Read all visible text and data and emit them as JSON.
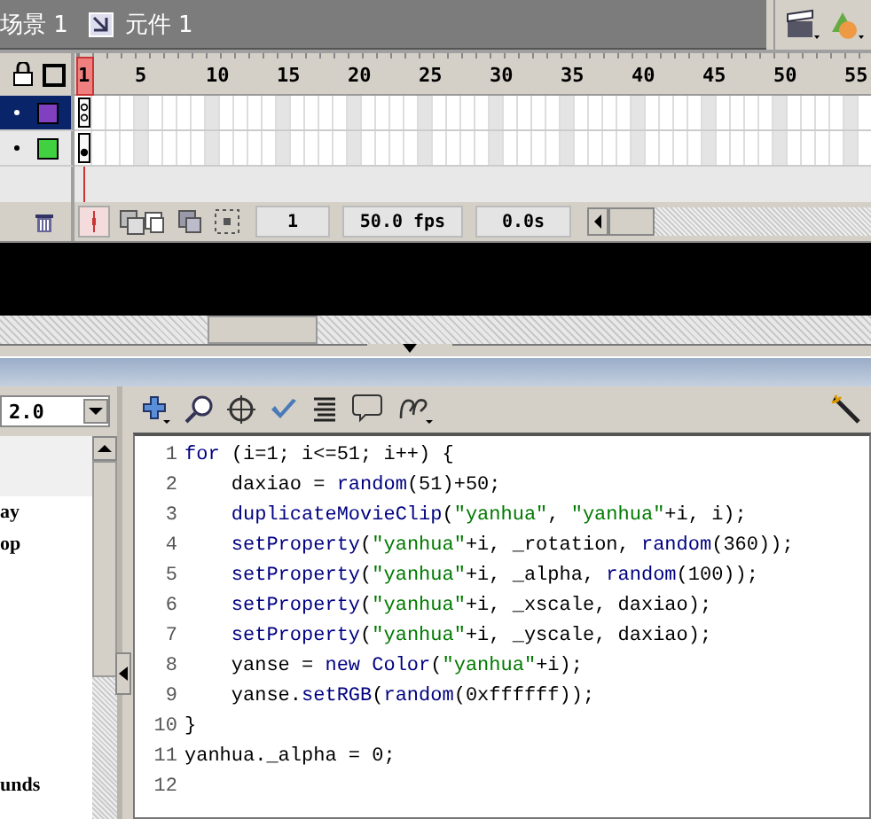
{
  "breadcrumb": [
    {
      "label": "场景 1",
      "kind": "scene"
    },
    {
      "label": "元件 1",
      "kind": "symbol"
    }
  ],
  "timeline": {
    "ruler": [
      "1",
      "5",
      "10",
      "15",
      "20",
      "25",
      "30",
      "35",
      "40",
      "45",
      "50",
      "55"
    ],
    "layers": [
      {
        "selected": true,
        "color": "#8040c0",
        "kind": "action"
      },
      {
        "selected": false,
        "color": "#40d040",
        "kind": "filled"
      }
    ],
    "current_frame": "1",
    "frame_rate": "50.0 fps",
    "elapsed": "0.0s"
  },
  "actions": {
    "version": "2.0",
    "list": [
      {
        "label": "ay"
      },
      {
        "label": "op"
      },
      {
        "label": "unds"
      }
    ],
    "code": [
      {
        "number": "1",
        "segments": [
          {
            "text": "for",
            "kind": "keyword"
          },
          {
            "text": " (i=1; i<=51; i++) {",
            "kind": "plain"
          }
        ]
      },
      {
        "number": "2",
        "segments": [
          {
            "text": "    daxiao = ",
            "kind": "plain"
          },
          {
            "text": "random",
            "kind": "keyword"
          },
          {
            "text": "(51)+50;",
            "kind": "plain"
          }
        ]
      },
      {
        "number": "3",
        "segments": [
          {
            "text": "    duplicateMovieClip",
            "kind": "keyword"
          },
          {
            "text": "(",
            "kind": "plain"
          },
          {
            "text": "\"yanhua\"",
            "kind": "string"
          },
          {
            "text": ", ",
            "kind": "plain"
          },
          {
            "text": "\"yanhua\"",
            "kind": "string"
          },
          {
            "text": "+i, i);",
            "kind": "plain"
          }
        ]
      },
      {
        "number": "4",
        "segments": [
          {
            "text": "    setProperty",
            "kind": "keyword"
          },
          {
            "text": "(",
            "kind": "plain"
          },
          {
            "text": "\"yanhua\"",
            "kind": "string"
          },
          {
            "text": "+i, _rotation, ",
            "kind": "plain"
          },
          {
            "text": "random",
            "kind": "keyword"
          },
          {
            "text": "(360));",
            "kind": "plain"
          }
        ]
      },
      {
        "number": "5",
        "segments": [
          {
            "text": "    setProperty",
            "kind": "keyword"
          },
          {
            "text": "(",
            "kind": "plain"
          },
          {
            "text": "\"yanhua\"",
            "kind": "string"
          },
          {
            "text": "+i, _alpha, ",
            "kind": "plain"
          },
          {
            "text": "random",
            "kind": "keyword"
          },
          {
            "text": "(100));",
            "kind": "plain"
          }
        ]
      },
      {
        "number": "6",
        "segments": [
          {
            "text": "    setProperty",
            "kind": "keyword"
          },
          {
            "text": "(",
            "kind": "plain"
          },
          {
            "text": "\"yanhua\"",
            "kind": "string"
          },
          {
            "text": "+i, _xscale, daxiao);",
            "kind": "plain"
          }
        ]
      },
      {
        "number": "7",
        "segments": [
          {
            "text": "    setProperty",
            "kind": "keyword"
          },
          {
            "text": "(",
            "kind": "plain"
          },
          {
            "text": "\"yanhua\"",
            "kind": "string"
          },
          {
            "text": "+i, _yscale, daxiao);",
            "kind": "plain"
          }
        ]
      },
      {
        "number": "8",
        "segments": [
          {
            "text": "    yanse = ",
            "kind": "plain"
          },
          {
            "text": "new Color",
            "kind": "keyword"
          },
          {
            "text": "(",
            "kind": "plain"
          },
          {
            "text": "\"yanhua\"",
            "kind": "string"
          },
          {
            "text": "+i);",
            "kind": "plain"
          }
        ]
      },
      {
        "number": "9",
        "segments": [
          {
            "text": "    yanse.",
            "kind": "plain"
          },
          {
            "text": "setRGB",
            "kind": "keyword"
          },
          {
            "text": "(",
            "kind": "plain"
          },
          {
            "text": "random",
            "kind": "keyword"
          },
          {
            "text": "(0xffffff));",
            "kind": "plain"
          }
        ]
      },
      {
        "number": "10",
        "segments": [
          {
            "text": "}",
            "kind": "plain"
          }
        ]
      },
      {
        "number": "11",
        "segments": [
          {
            "text": "yanhua._alpha = 0;",
            "kind": "plain"
          }
        ]
      },
      {
        "number": "12"
      }
    ]
  }
}
